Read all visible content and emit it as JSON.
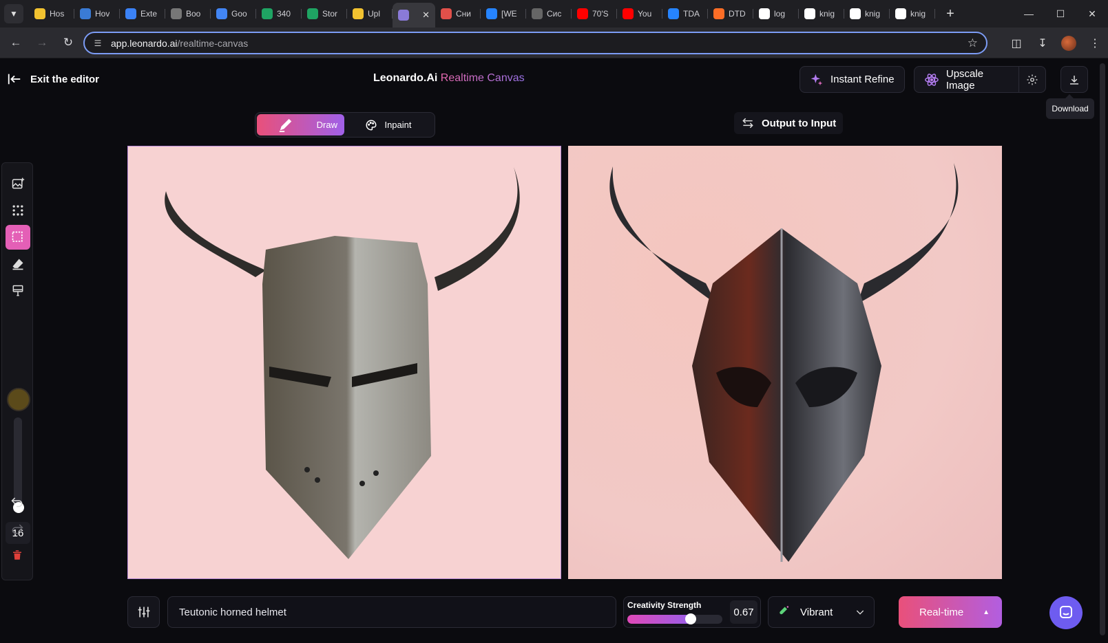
{
  "browser": {
    "tabs": [
      {
        "label": "Hos",
        "icon": "smiley-favicon",
        "color": "#f2c230"
      },
      {
        "label": "Hov",
        "icon": "camera-favicon",
        "color": "#3a7bd5"
      },
      {
        "label": "Exte",
        "icon": "puzzle-favicon",
        "color": "#3b82f6"
      },
      {
        "label": "Boo",
        "icon": "gear-favicon",
        "color": "#777777"
      },
      {
        "label": "Goo",
        "icon": "translate-favicon",
        "color": "#4285f4"
      },
      {
        "label": "340",
        "icon": "sheets-favicon",
        "color": "#1fa463"
      },
      {
        "label": "Stor",
        "icon": "store-favicon",
        "color": "#1fa463"
      },
      {
        "label": "Upl",
        "icon": "folder-favicon",
        "color": "#f2c230"
      },
      {
        "label": "",
        "icon": "leonardo-favicon",
        "color": "#8a7ad8",
        "active": true
      },
      {
        "label": "Сни",
        "icon": "ship-favicon",
        "color": "#e0504a"
      },
      {
        "label": "[WE",
        "icon": "diamond-favicon",
        "color": "#2684ff"
      },
      {
        "label": "Сис",
        "icon": "globe-favicon",
        "color": "#666666"
      },
      {
        "label": "70'S",
        "icon": "youtube-favicon",
        "color": "#ff0000"
      },
      {
        "label": "You",
        "icon": "youtube-favicon",
        "color": "#ff0000"
      },
      {
        "label": "TDA",
        "icon": "diamond-favicon",
        "color": "#2684ff"
      },
      {
        "label": "DTD",
        "icon": "gitlab-favicon",
        "color": "#fc6d26"
      },
      {
        "label": "log",
        "icon": "google-favicon",
        "color": "#ffffff"
      },
      {
        "label": "knig",
        "icon": "google-favicon",
        "color": "#ffffff"
      },
      {
        "label": "knig",
        "icon": "google-favicon",
        "color": "#ffffff"
      },
      {
        "label": "knig",
        "icon": "google-favicon",
        "color": "#ffffff"
      }
    ],
    "url_host": "app.leonardo.ai",
    "url_path": "/realtime-canvas"
  },
  "header": {
    "exit_label": "Exit the editor",
    "title_brand": "Leonardo.Ai",
    "title_product": "Realtime Canvas",
    "instant_refine_label": "Instant Refine",
    "upscale_label": "Upscale Image",
    "download_tooltip": "Download"
  },
  "modes": {
    "draw_label": "Draw",
    "inpaint_label": "Inpaint",
    "selected": "Draw"
  },
  "output_to_input_label": "Output to Input",
  "toolbox": {
    "brush_color": "#5b4a1a",
    "brush_size": "16"
  },
  "bottom": {
    "prompt_value": "Teutonic horned helmet",
    "creativity_label": "Creativity Strength",
    "creativity_value": "0.67",
    "creativity_fraction": 0.67,
    "style_label": "Vibrant",
    "generate_label": "Real-time"
  },
  "colors": {
    "accent_pink": "#e9507a",
    "accent_purple": "#a060e8",
    "canvas_bg": "#f6cfcf"
  }
}
